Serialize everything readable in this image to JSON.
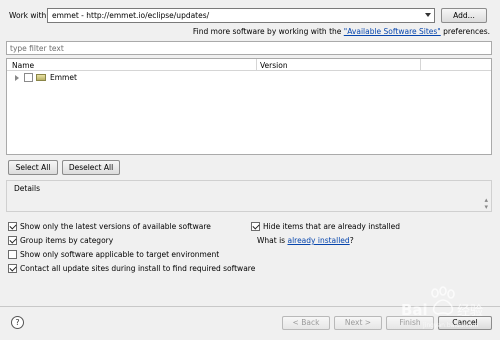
{
  "work_with": {
    "label": "Work with:",
    "value": "emmet - http://emmet.io/eclipse/updates/",
    "add_label": "Add..."
  },
  "find_more": {
    "prefix": "Find more software by working with the ",
    "link": "\"Available Software Sites\"",
    "suffix": " preferences."
  },
  "filter": {
    "placeholder": "type filter text"
  },
  "table": {
    "columns": [
      "Name",
      "Version"
    ],
    "rows": [
      {
        "name": "Emmet",
        "version": "",
        "checked": false
      }
    ]
  },
  "buttons": {
    "select_all": "Select All",
    "deselect_all": "Deselect All"
  },
  "details": {
    "title": "Details"
  },
  "options": {
    "latest_versions": {
      "label": "Show only the latest versions of available software",
      "checked": true
    },
    "group_by_category": {
      "label": "Group items by category",
      "checked": true
    },
    "target_env": {
      "label": "Show only software applicable to target environment",
      "checked": false
    },
    "contact_sites": {
      "label": "Contact all update sites during install to find required software",
      "checked": true
    },
    "hide_installed": {
      "label": "Hide items that are already installed",
      "checked": true
    }
  },
  "what_is": {
    "prefix": "What is ",
    "link": "already installed",
    "suffix": "?"
  },
  "footer": {
    "help": "?",
    "back": "< Back",
    "next": "Next >",
    "finish": "Finish",
    "cancel": "Cancel"
  },
  "watermark": {
    "text": "Baidu 经验",
    "subtext": "jingyan.baidu.com"
  }
}
